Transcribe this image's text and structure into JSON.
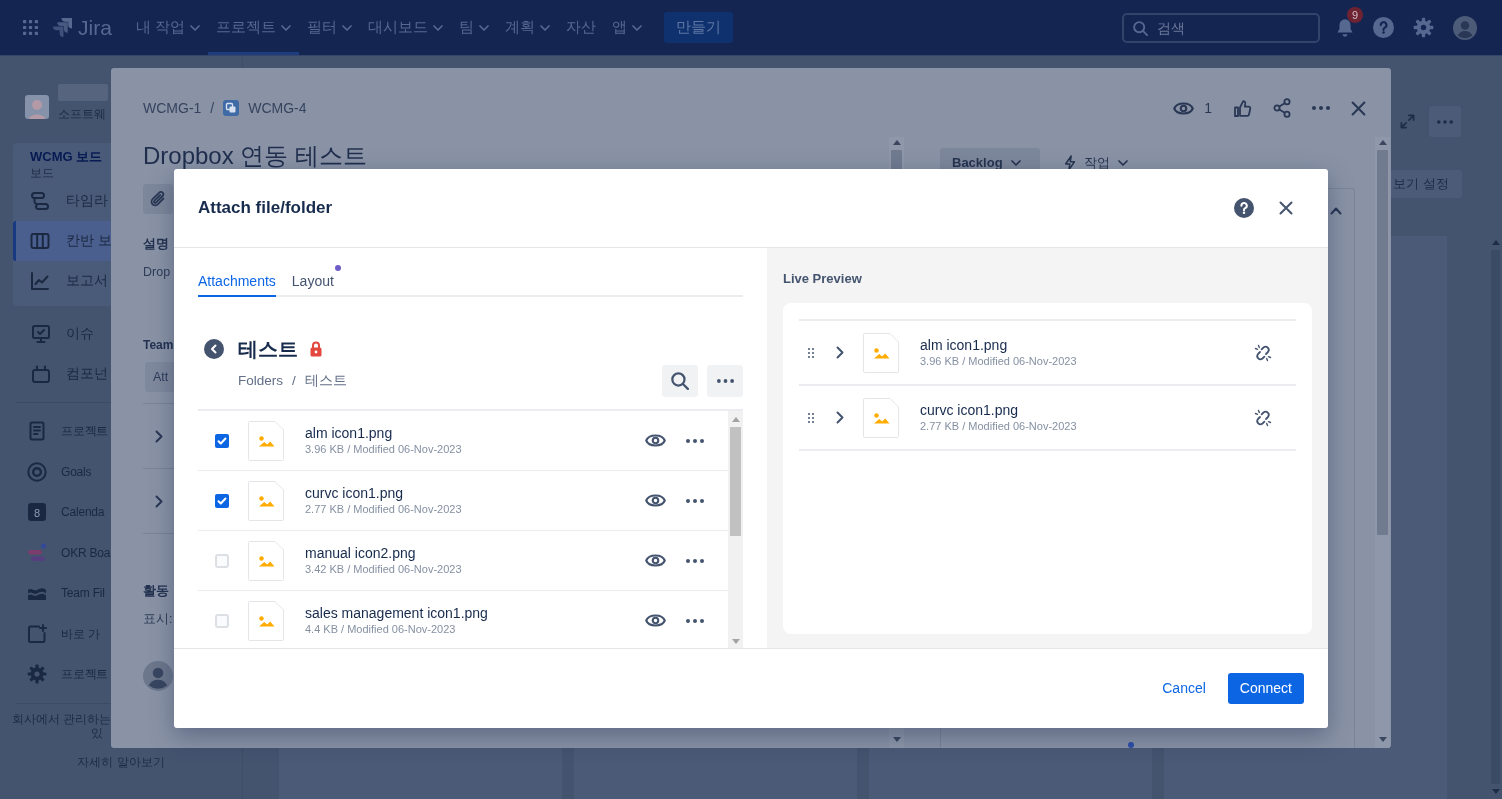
{
  "top_nav": {
    "logo_text": "Jira",
    "menu": [
      {
        "label": "내 작업",
        "has_menu": true,
        "selected": false
      },
      {
        "label": "프로젝트",
        "has_menu": true,
        "selected": true
      },
      {
        "label": "필터",
        "has_menu": true,
        "selected": false
      },
      {
        "label": "대시보드",
        "has_menu": true,
        "selected": false
      },
      {
        "label": "팀",
        "has_menu": true,
        "selected": false
      },
      {
        "label": "계획",
        "has_menu": true,
        "selected": false
      },
      {
        "label": "자산",
        "has_menu": false,
        "selected": false
      },
      {
        "label": "앱",
        "has_menu": true,
        "selected": false
      }
    ],
    "create_button": "만들기",
    "search": {
      "placeholder": "검색"
    },
    "notification_count": "9"
  },
  "sidebar": {
    "project_type": "소프트웨",
    "board_group": {
      "title": "WCMG 보드",
      "subtitle": "보드",
      "items": [
        {
          "label": "타임라",
          "selected": false
        },
        {
          "label": "칸반 보",
          "selected": true
        },
        {
          "label": "보고서",
          "selected": false
        }
      ]
    },
    "items": [
      {
        "label": "이슈"
      },
      {
        "label": "컴포넌"
      }
    ],
    "more_items": [
      {
        "label": "프로젝트"
      },
      {
        "label": "Goals"
      },
      {
        "label": "Calenda",
        "icon_text": "8"
      },
      {
        "label": "OKR Boa"
      },
      {
        "label": "Team Fil"
      },
      {
        "label": "바로 가"
      },
      {
        "label": "프로젝트"
      }
    ],
    "footer_note": [
      "회사에서 관리하는",
      "있"
    ],
    "learn_more": "자세히 알아보기"
  },
  "board": {
    "view_settings_button": "보기 설정"
  },
  "issue": {
    "breadcrumbs": [
      "WCMG-1",
      "WCMG-4"
    ],
    "breadcrumb_separator": "/",
    "watchers": "1",
    "title": "Dropbox 연동 테스트",
    "description_label": "설명",
    "description": "Drop",
    "team_label": "Team",
    "team_button": "Att",
    "sections": [
      {
        "expanded": false
      },
      {
        "expanded": false
      }
    ],
    "activity_label": "활동",
    "show_label": "표시:",
    "status_button": "Backlog",
    "action_button": "작업",
    "details_panel": {
      "expanded": true
    }
  },
  "dialog": {
    "title": "Attach file/folder",
    "tabs": [
      {
        "label": "Attachments",
        "selected": true,
        "has_dot": false
      },
      {
        "label": "Layout",
        "selected": false,
        "has_dot": true
      }
    ],
    "folder": {
      "name": "테스트",
      "locked": true,
      "breadcrumbs": [
        "Folders",
        "테스트"
      ],
      "breadcrumb_separator": "/"
    },
    "files": [
      {
        "name": "alm icon1.png",
        "details": "3.96 KB / Modified 06-Nov-2023",
        "checked": true
      },
      {
        "name": "curvc icon1.png",
        "details": "2.77 KB / Modified 06-Nov-2023",
        "checked": true
      },
      {
        "name": "manual icon2.png",
        "details": "3.42 KB / Modified 06-Nov-2023",
        "checked": false
      },
      {
        "name": "sales management icon1.png",
        "details": "4.4 KB / Modified 06-Nov-2023",
        "checked": false
      }
    ],
    "preview": {
      "title": "Live Preview",
      "items": [
        {
          "name": "alm icon1.png",
          "details": "3.96 KB / Modified 06-Nov-2023",
          "expanded": false
        },
        {
          "name": "curvc icon1.png",
          "details": "2.77 KB / Modified 06-Nov-2023",
          "expanded": false
        }
      ]
    },
    "cancel_button": "Cancel",
    "connect_button": "Connect"
  }
}
